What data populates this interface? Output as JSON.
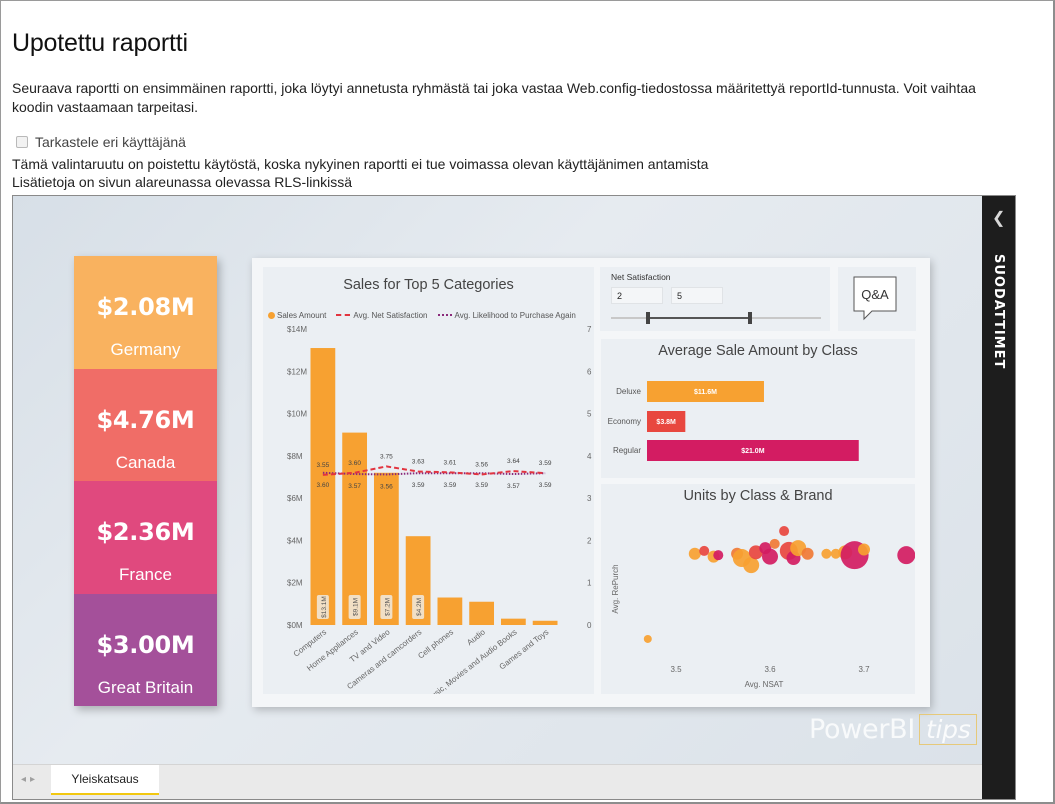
{
  "page": {
    "title": "Upotettu raportti",
    "description": "Seuraava raportti on ensimmäinen raportti, joka löytyi annetusta ryhmästä tai joka vastaa Web.config-tiedostossa määritettyä reportId-tunnusta. Voit vaihtaa koodin vastaamaan tarpeitasi.",
    "checkbox_label": "Tarkastele eri käyttäjänä",
    "note_line1": "Tämä valintaruutu on poistettu käytöstä, koska nykyinen raportti ei tue voimassa olevan käyttäjänimen antamista",
    "note_line2": "Lisätietoja on sivun alareunassa olevassa RLS-linkissä"
  },
  "cards": [
    {
      "value": "$2.08M",
      "label": "Germany",
      "color": "#f9b25f"
    },
    {
      "value": "$4.76M",
      "label": "Canada",
      "color": "#f06d67"
    },
    {
      "value": "$2.36M",
      "label": "France",
      "color": "#e0497e"
    },
    {
      "value": "$3.00M",
      "label": "Great Britain",
      "color": "#a4509a"
    }
  ],
  "slicer": {
    "title": "Net Satisfaction",
    "min": "2",
    "max": "5"
  },
  "qa_label": "Q&A",
  "filters_label": "SUODATTIMET",
  "logo": {
    "main": "PowerBI",
    "tips": "tips"
  },
  "tabs": {
    "active": "Yleiskatsaus"
  },
  "chart_data": [
    {
      "type": "bar",
      "title": "Sales for Top 5 Categories",
      "categories": [
        "Computers",
        "Home Appliances",
        "TV and Video",
        "Cameras and camcorders",
        "Cell phones",
        "Audio",
        "Music, Movies and Audio Books",
        "Games and Toys"
      ],
      "series": [
        {
          "name": "Sales Amount",
          "values": [
            13.1,
            9.1,
            7.2,
            4.2,
            1.3,
            1.1,
            0.3,
            0.2
          ],
          "color": "#f7a131",
          "labels": [
            "$13.1M",
            "$9.1M",
            "$7.2M",
            "$4.2M",
            "",
            "",
            "",
            ""
          ]
        },
        {
          "name": "Avg. Net Satisfaction",
          "values": [
            3.55,
            3.6,
            3.75,
            3.63,
            3.61,
            3.56,
            3.64,
            3.59
          ],
          "color": "#e2343f"
        },
        {
          "name": "Avg. Likelihood to Purchase Again",
          "values": [
            3.6,
            3.57,
            3.56,
            3.59,
            3.59,
            3.59,
            3.57,
            3.59
          ],
          "color": "#8a2a7a"
        }
      ],
      "y_left_ticks": [
        "$0M",
        "$2M",
        "$4M",
        "$6M",
        "$8M",
        "$10M",
        "$12M",
        "$14M"
      ],
      "y_left_range": [
        0,
        14
      ],
      "y_right_ticks": [
        "0",
        "1",
        "2",
        "3",
        "4",
        "5",
        "6",
        "7"
      ],
      "y_right_range": [
        0,
        7
      ],
      "top_labels": [
        "3.55",
        "3.60",
        "3.75",
        "3.63",
        "3.61",
        "3.56",
        "3.64",
        "3.59"
      ],
      "bottom_labels": [
        "3.60",
        "3.57",
        "3.56",
        "3.59",
        "3.59",
        "3.59",
        "3.57",
        "3.59"
      ]
    },
    {
      "type": "bar",
      "title": "Average Sale Amount by Class",
      "categories": [
        "Deluxe",
        "Economy",
        "Regular"
      ],
      "values": [
        11.6,
        3.8,
        21.0
      ],
      "labels": [
        "$11.6M",
        "$3.8M",
        "$21.0M"
      ],
      "colors": [
        "#f7a131",
        "#e8473f",
        "#d31c62"
      ],
      "xlim": [
        0,
        24
      ]
    },
    {
      "type": "scatter",
      "title": "Units by Class & Brand",
      "xlabel": "Avg. NSAT",
      "ylabel": "Avg. RePurch",
      "x_ticks": [
        "3.5",
        "3.6",
        "3.7"
      ],
      "xlim": [
        3.45,
        3.75
      ],
      "points": [
        {
          "x": 3.47,
          "y": 0.12,
          "r": 4,
          "c": "#f7a131"
        },
        {
          "x": 3.52,
          "y": 0.72,
          "r": 6,
          "c": "#f7a131"
        },
        {
          "x": 3.53,
          "y": 0.74,
          "r": 5,
          "c": "#e8473f"
        },
        {
          "x": 3.54,
          "y": 0.7,
          "r": 6,
          "c": "#f7a131"
        },
        {
          "x": 3.545,
          "y": 0.71,
          "r": 5,
          "c": "#d31c62"
        },
        {
          "x": 3.565,
          "y": 0.72,
          "r": 6,
          "c": "#f07a35"
        },
        {
          "x": 3.57,
          "y": 0.69,
          "r": 9,
          "c": "#f7a131"
        },
        {
          "x": 3.58,
          "y": 0.64,
          "r": 8,
          "c": "#f7a131"
        },
        {
          "x": 3.585,
          "y": 0.73,
          "r": 7,
          "c": "#e8473f"
        },
        {
          "x": 3.595,
          "y": 0.76,
          "r": 6,
          "c": "#d31c62"
        },
        {
          "x": 3.6,
          "y": 0.7,
          "r": 8,
          "c": "#d31c62"
        },
        {
          "x": 3.605,
          "y": 0.79,
          "r": 5,
          "c": "#f07a35"
        },
        {
          "x": 3.615,
          "y": 0.88,
          "r": 5,
          "c": "#e8473f"
        },
        {
          "x": 3.62,
          "y": 0.74,
          "r": 9,
          "c": "#e8473f"
        },
        {
          "x": 3.625,
          "y": 0.69,
          "r": 7,
          "c": "#d31c62"
        },
        {
          "x": 3.63,
          "y": 0.76,
          "r": 8,
          "c": "#f7a131"
        },
        {
          "x": 3.64,
          "y": 0.72,
          "r": 6,
          "c": "#f07a35"
        },
        {
          "x": 3.66,
          "y": 0.72,
          "r": 5,
          "c": "#f7a131"
        },
        {
          "x": 3.67,
          "y": 0.72,
          "r": 5,
          "c": "#f7a131"
        },
        {
          "x": 3.68,
          "y": 0.73,
          "r": 7,
          "c": "#f7a131"
        },
        {
          "x": 3.69,
          "y": 0.71,
          "r": 14,
          "c": "#d31c62"
        },
        {
          "x": 3.7,
          "y": 0.75,
          "r": 6,
          "c": "#f7a131"
        },
        {
          "x": 3.745,
          "y": 0.71,
          "r": 9,
          "c": "#d31c62"
        }
      ]
    }
  ]
}
